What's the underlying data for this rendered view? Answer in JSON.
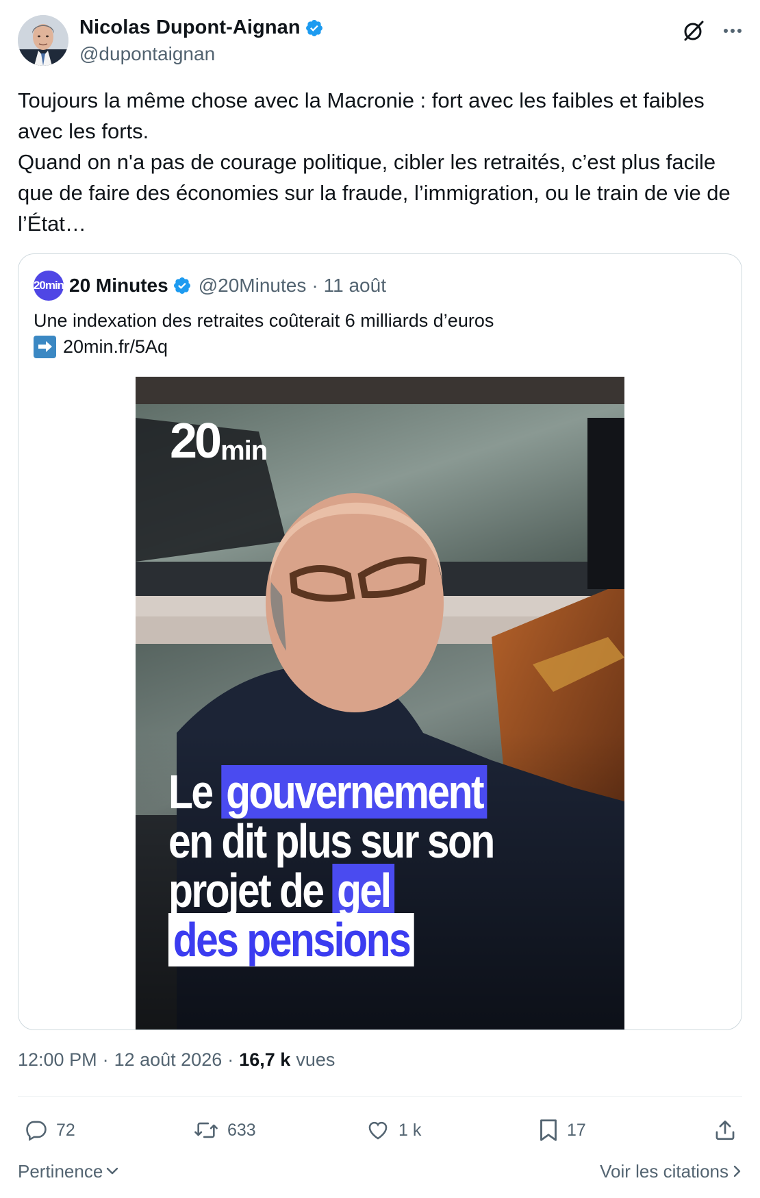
{
  "author": {
    "name": "Nicolas Dupont-Aignan",
    "handle": "@dupontaignan",
    "verified_icon": "verified-badge-icon"
  },
  "header_icons": [
    "grok-icon",
    "more-icon"
  ],
  "tweet": {
    "text": "Toujours la même chose avec la Macronie : fort avec les faibles et faibles avec les forts.\nQuand on n'a pas de courage politique, cibler les retraités, c’est plus facile que de faire des économies sur la fraude, l’immigration, ou le train de vie de l’État…"
  },
  "quote": {
    "avatar_text": "20min",
    "name": "20 Minutes",
    "handle": "@20Minutes",
    "dot": "·",
    "date": "11 août",
    "text": "Une indexation des retraites coûterait 6 milliards d’euros",
    "link_emoji": "right-arrow-emoji",
    "link": "20min.fr/5Aq",
    "image": {
      "logo_big": "20",
      "logo_small": "min",
      "headline": {
        "l1_a": "Le",
        "l1_b": "gouvernement",
        "l2": "en dit plus sur son",
        "l3_a": "projet de",
        "l3_b": "gel",
        "l4": "des pensions"
      },
      "accent_color": "#4a4bf0"
    }
  },
  "meta": {
    "time": "12:00 PM",
    "sep1": "·",
    "date": "12 août 2026",
    "sep2": "·",
    "views_count": "16,7 k",
    "views_label": "vues"
  },
  "actions": {
    "replies": "72",
    "retweets": "633",
    "likes": "1 k",
    "bookmarks": "17"
  },
  "footer": {
    "sort_label": "Pertinence",
    "view_quotes": "Voir les citations"
  },
  "colors": {
    "text_primary": "#0f1419",
    "text_secondary": "#536471",
    "verified_blue": "#1d9bf0",
    "border": "#cfd9de"
  }
}
